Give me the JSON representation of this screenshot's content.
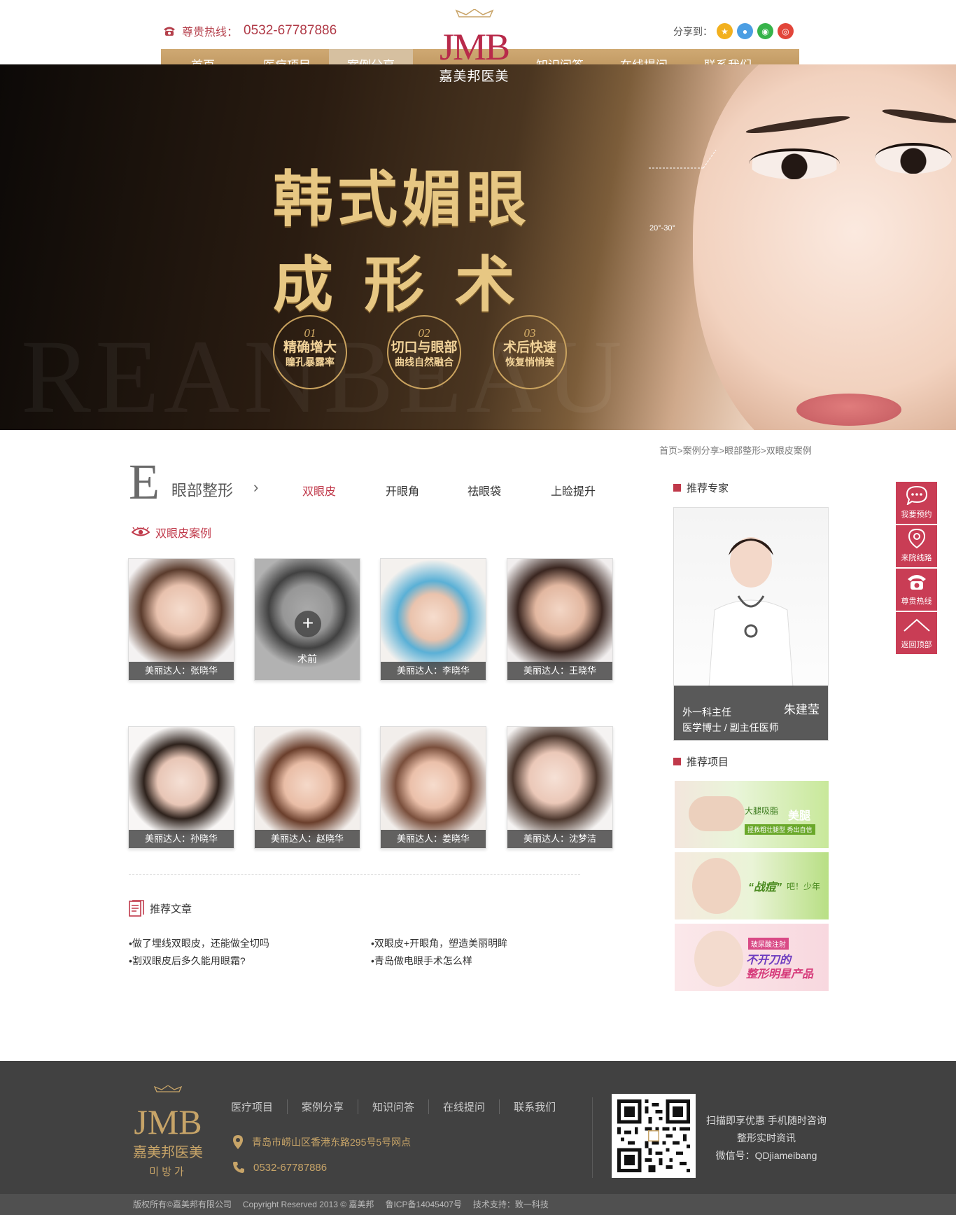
{
  "header": {
    "hotline_label": "尊贵热线：",
    "hotline_number": "0532-67787886",
    "share_label": "分享到：",
    "share_icons": [
      "qzone-icon",
      "qq-icon",
      "wechat-icon",
      "weibo-icon"
    ],
    "logo_mark": "JMB",
    "logo_name": "嘉美邦医美"
  },
  "nav": {
    "items": [
      {
        "label": "首页"
      },
      {
        "label": "医疗项目"
      },
      {
        "label": "案例分享"
      },
      {
        "label": "知识问答"
      },
      {
        "label": "在线提问"
      },
      {
        "label": "联系我们"
      }
    ],
    "active": "案例分享"
  },
  "banner": {
    "title_line1": "韩式媚眼",
    "title_line2": "成形术",
    "bg_word": "REANBEAU",
    "angle": "20°-30°",
    "features": [
      {
        "num": "01",
        "line1": "精确增大",
        "line2": "瞳孔暴露率"
      },
      {
        "num": "02",
        "line1": "切口与眼部",
        "line2": "曲线自然融合"
      },
      {
        "num": "03",
        "line1": "术后快速",
        "line2": "恢复悄悄美"
      }
    ]
  },
  "breadcrumb": "首页>案例分享>眼部整形>双眼皮案例",
  "section": {
    "letter": "E",
    "title": "眼部整形",
    "tabs": [
      "双眼皮",
      "开眼角",
      "祛眼袋",
      "上睑提升"
    ],
    "active_tab": "双眼皮",
    "subtitle": "双眼皮案例"
  },
  "cases": [
    {
      "caption": "美丽达人：张晓华"
    },
    {
      "caption": "术前"
    },
    {
      "caption": "美丽达人：李晓华"
    },
    {
      "caption": "美丽达人：王晓华"
    },
    {
      "caption": "美丽达人：孙晓华"
    },
    {
      "caption": "美丽达人：赵晓华"
    },
    {
      "caption": "美丽达人：姜晓华"
    },
    {
      "caption": "美丽达人：沈梦洁"
    }
  ],
  "articles": {
    "title": "推荐文章",
    "items": [
      "•做了埋线双眼皮，还能做全切吗",
      "•双眼皮+开眼角，塑造美丽明眸",
      "•割双眼皮后多久能用眼霜?",
      "•青岛做电眼手术怎么样"
    ]
  },
  "sidebar": {
    "expert_title": "推荐专家",
    "expert_name": "朱建莹",
    "expert_role": "外一科主任",
    "expert_desc": "医学博士 / 副主任医师",
    "projects_title": "推荐项目",
    "proj1_a": "大腿吸脂",
    "proj1_b": "美腿",
    "proj1_c": "拯救粗壮腿型 秀出自信",
    "proj2_a": "“战痘”",
    "proj2_b": "吧！少年",
    "proj3_tag": "玻尿酸注射",
    "proj3_a": "不开刀的",
    "proj3_b": "整形明星产品"
  },
  "floatbar": [
    "我要预约",
    "来院线路",
    "尊贵热线",
    "返回顶部"
  ],
  "footer": {
    "logo_mark": "JMB",
    "logo_name": "嘉美邦医美",
    "logo_kr": "미방가",
    "nav": [
      "医疗项目",
      "案例分享",
      "知识问答",
      "在线提问",
      "联系我们"
    ],
    "address": "青岛市崂山区香港东路295号5号网点",
    "phone": "0532-67787886",
    "qr_text1": "扫描即享优惠 手机随时咨询",
    "qr_text2": "整形实时资讯",
    "qr_text3": "微信号：QDjiameibang",
    "copyright": "版权所有©嘉美邦有限公司",
    "reserved": "Copyright Reserved 2013 © 嘉美邦",
    "icp": "鲁ICP备14045407号",
    "support": "技术支持：致一科技"
  },
  "colors": {
    "gold": "#c9a468",
    "accent": "#c0394a",
    "footer_bg": "#414141"
  }
}
